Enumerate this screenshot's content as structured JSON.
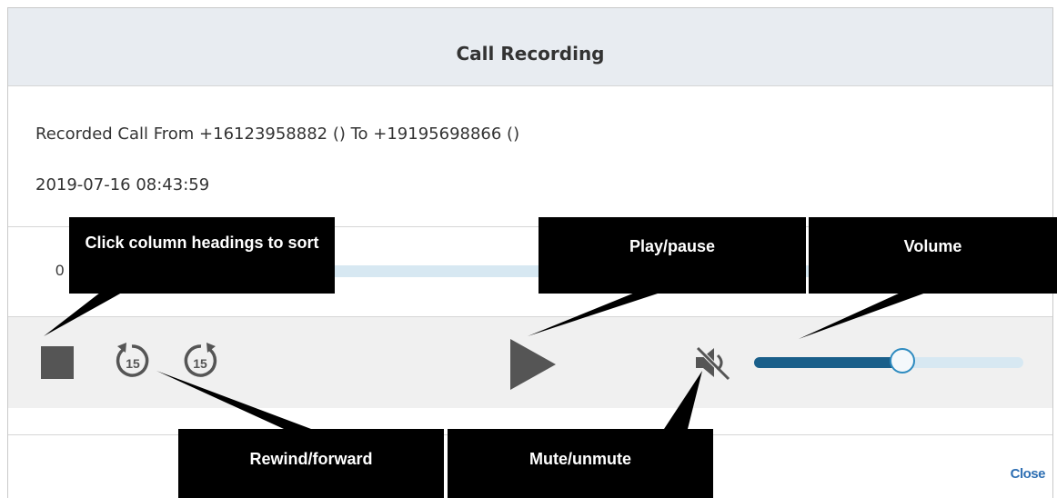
{
  "dialog": {
    "title": "Call Recording",
    "recorded_from": "Recorded Call From +16123958882 () To +19195698866 ()",
    "timestamp": "2019-07-16 08:43:59",
    "close_label": "Close"
  },
  "player": {
    "time_label": "0",
    "progress": 0,
    "volume": 0.55,
    "rewind_seconds": "15",
    "forward_seconds": "15",
    "icons": [
      "stop-icon",
      "rewind-15-icon",
      "forward-15-icon",
      "play-icon",
      "mute-icon"
    ],
    "accent_color": "#1a5f8a",
    "track_color": "#d7e8f2"
  },
  "callouts": {
    "sort": "Click column headings to sort",
    "play": "Play/pause",
    "volume": "Volume",
    "rewind": "Rewind/forward",
    "mute": "Mute/unmute"
  }
}
